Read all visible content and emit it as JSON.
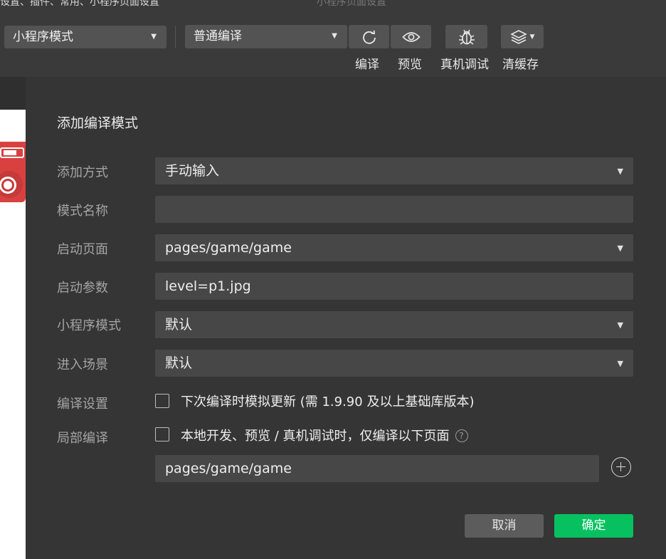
{
  "toolbar": {
    "title_fragments": [
      "设置、插件、常用、小程序页面设置",
      "小程序页面设置"
    ],
    "mode_select": "小程序模式",
    "compile_select": "普通编译",
    "labels": {
      "compile": "编译",
      "preview": "预览",
      "remote_debug": "真机调试",
      "clear_cache": "清缓存"
    }
  },
  "dialog": {
    "title": "添加编译模式",
    "rows": {
      "add_method": {
        "label": "添加方式",
        "value": "手动输入"
      },
      "mode_name": {
        "label": "模式名称",
        "value": ""
      },
      "start_page": {
        "label": "启动页面",
        "value": "pages/game/game"
      },
      "start_params": {
        "label": "启动参数",
        "value": "level=p1.jpg"
      },
      "mp_mode": {
        "label": "小程序模式",
        "value": "默认"
      },
      "scene": {
        "label": "进入场景",
        "value": "默认"
      },
      "compile_settings": {
        "label": "编译设置",
        "checkbox_text": "下次编译时模拟更新 (需 1.9.90 及以上基础库版本)",
        "checked": false
      },
      "partial_compile": {
        "label": "局部编译",
        "checkbox_text": "本地开发、预览 / 真机调试时，仅编译以下页面",
        "checked": false,
        "page": "pages/game/game"
      }
    },
    "help_glyph": "?",
    "cancel": "取消",
    "confirm": "确定"
  },
  "colors": {
    "accent": "#07c160",
    "dialog_bg": "#353535",
    "field_bg": "#474747"
  }
}
